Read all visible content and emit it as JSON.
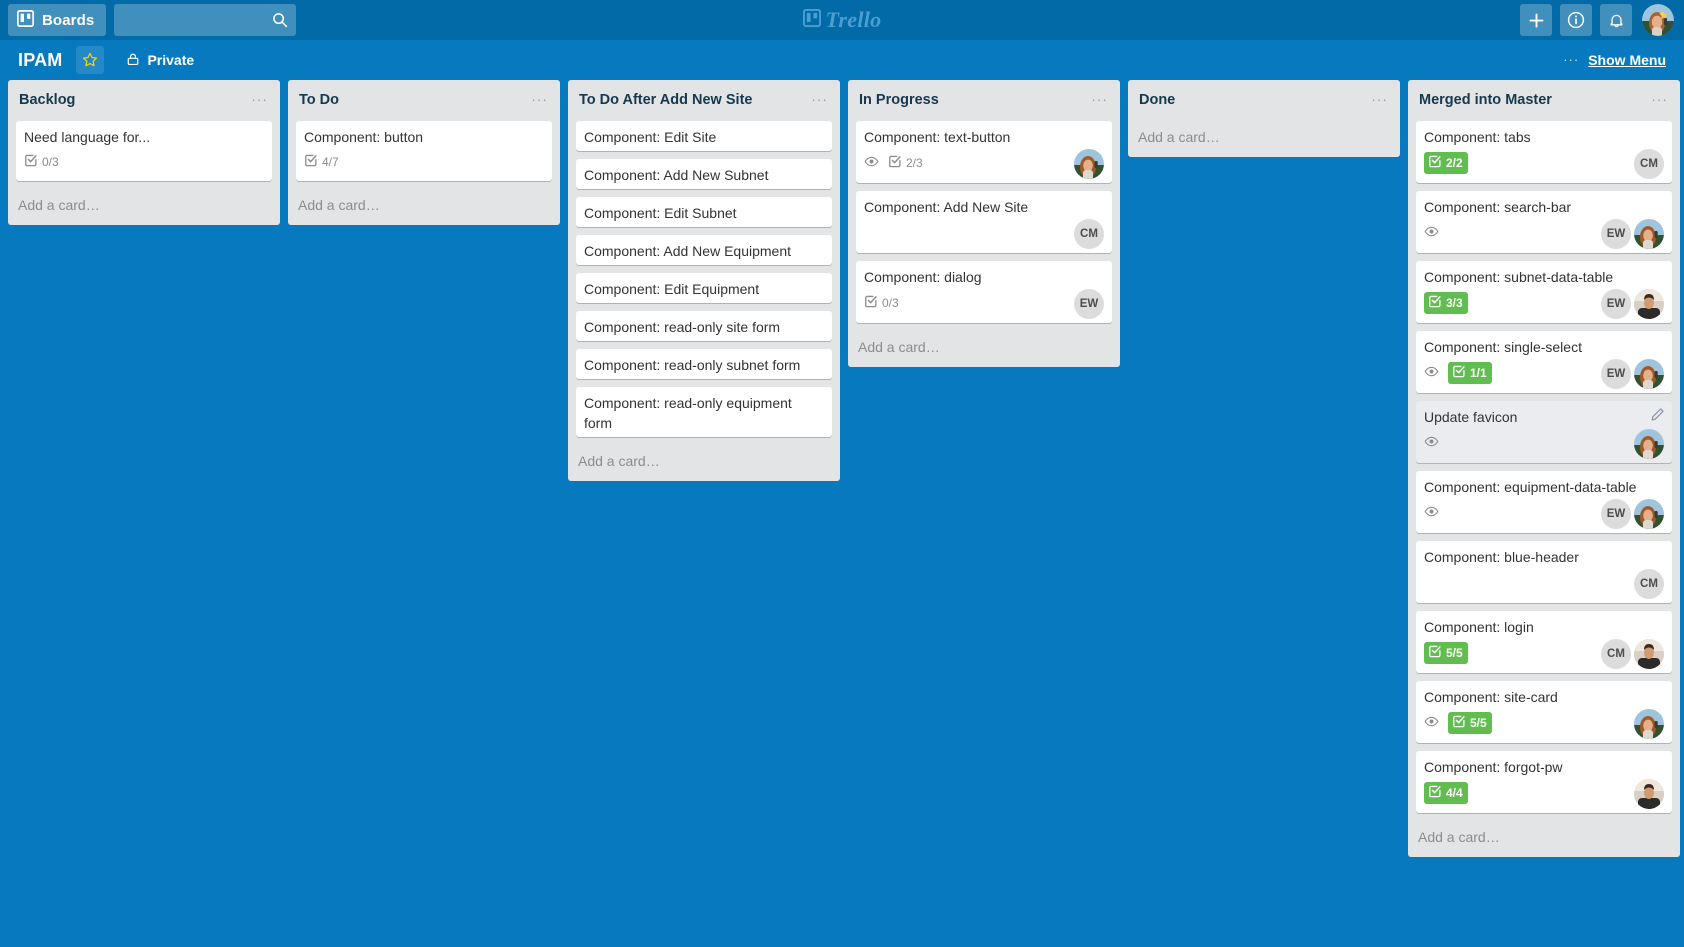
{
  "header": {
    "boards_label": "Boards",
    "search_placeholder": "",
    "search_value": "",
    "logo_text": "Trello",
    "icons": {
      "boards": "boards-icon",
      "search": "search-icon",
      "add": "plus-icon",
      "info": "info-icon",
      "notifications": "bell-icon",
      "avatar": "user-avatar"
    }
  },
  "board": {
    "title": "IPAM",
    "starred": true,
    "visibility": "Private",
    "dots": "···",
    "show_menu": "Show Menu"
  },
  "add_card_label": "Add a card…",
  "list_menu_dots": "···",
  "colors": {
    "board_bg": "#0679bf",
    "top_bar": "#026aa7",
    "list_bg": "#e2e4e6",
    "card_bg": "#ffffff",
    "badge_complete": "#61bd4f",
    "title_text": "#17394d"
  },
  "lists": [
    {
      "name": "Backlog",
      "cards": [
        {
          "title": "Need language for...",
          "badges": [
            {
              "type": "checklist",
              "text": "0/3",
              "complete": false
            }
          ],
          "members": []
        }
      ]
    },
    {
      "name": "To Do",
      "cards": [
        {
          "title": "Component: button",
          "badges": [
            {
              "type": "checklist",
              "text": "4/7",
              "complete": false
            }
          ],
          "members": []
        }
      ]
    },
    {
      "name": "To Do After Add New Site",
      "cards": [
        {
          "title": "Component: Edit Site",
          "badges": [],
          "members": []
        },
        {
          "title": "Component: Add New Subnet",
          "badges": [],
          "members": []
        },
        {
          "title": "Component: Edit Subnet",
          "badges": [],
          "members": []
        },
        {
          "title": "Component: Add New Equipment",
          "badges": [],
          "members": []
        },
        {
          "title": "Component: Edit Equipment",
          "badges": [],
          "members": []
        },
        {
          "title": "Component: read-only site form",
          "badges": [],
          "members": []
        },
        {
          "title": "Component: read-only subnet form",
          "badges": [],
          "members": []
        },
        {
          "title": "Component: read-only equipment form",
          "badges": [],
          "members": []
        }
      ]
    },
    {
      "name": "In Progress",
      "cards": [
        {
          "title": "Component: text-button",
          "badges": [
            {
              "type": "watch",
              "text": ""
            },
            {
              "type": "checklist",
              "text": "2/3",
              "complete": false
            }
          ],
          "members": [
            {
              "type": "photo",
              "photo": "woman"
            }
          ]
        },
        {
          "title": "Component: Add New Site",
          "badges": [],
          "members": [
            {
              "type": "initials",
              "initials": "CM"
            }
          ]
        },
        {
          "title": "Component: dialog",
          "badges": [
            {
              "type": "checklist",
              "text": "0/3",
              "complete": false
            }
          ],
          "members": [
            {
              "type": "initials",
              "initials": "EW"
            }
          ]
        }
      ]
    },
    {
      "name": "Done",
      "cards": []
    },
    {
      "name": "Merged into Master",
      "cards": [
        {
          "title": "Component: tabs",
          "badges": [
            {
              "type": "checklist",
              "text": "2/2",
              "complete": true
            }
          ],
          "members": [
            {
              "type": "initials",
              "initials": "CM"
            }
          ]
        },
        {
          "title": "Component: search-bar",
          "badges": [
            {
              "type": "watch",
              "text": ""
            }
          ],
          "members": [
            {
              "type": "initials",
              "initials": "EW"
            },
            {
              "type": "photo",
              "photo": "woman"
            }
          ]
        },
        {
          "title": "Component: subnet-data-table",
          "badges": [
            {
              "type": "checklist",
              "text": "3/3",
              "complete": true
            }
          ],
          "members": [
            {
              "type": "initials",
              "initials": "EW"
            },
            {
              "type": "photo",
              "photo": "man"
            }
          ]
        },
        {
          "title": "Component: single-select",
          "badges": [
            {
              "type": "watch",
              "text": ""
            },
            {
              "type": "checklist",
              "text": "1/1",
              "complete": true
            }
          ],
          "members": [
            {
              "type": "initials",
              "initials": "EW"
            },
            {
              "type": "photo",
              "photo": "woman"
            }
          ]
        },
        {
          "title": "Update favicon",
          "hovered": true,
          "edit_pencil": true,
          "badges": [
            {
              "type": "watch",
              "text": ""
            }
          ],
          "members": [
            {
              "type": "photo",
              "photo": "woman"
            }
          ]
        },
        {
          "title": "Component: equipment-data-table",
          "badges": [
            {
              "type": "watch",
              "text": ""
            }
          ],
          "members": [
            {
              "type": "initials",
              "initials": "EW"
            },
            {
              "type": "photo",
              "photo": "woman"
            }
          ]
        },
        {
          "title": "Component: blue-header",
          "badges": [],
          "members": [
            {
              "type": "initials",
              "initials": "CM"
            }
          ]
        },
        {
          "title": "Component: login",
          "badges": [
            {
              "type": "checklist",
              "text": "5/5",
              "complete": true
            }
          ],
          "members": [
            {
              "type": "initials",
              "initials": "CM"
            },
            {
              "type": "photo",
              "photo": "man"
            }
          ]
        },
        {
          "title": "Component: site-card",
          "badges": [
            {
              "type": "watch",
              "text": ""
            },
            {
              "type": "checklist",
              "text": "5/5",
              "complete": true
            }
          ],
          "members": [
            {
              "type": "photo",
              "photo": "woman"
            }
          ]
        },
        {
          "title": "Component: forgot-pw",
          "badges": [
            {
              "type": "checklist",
              "text": "4/4",
              "complete": true
            }
          ],
          "members": [
            {
              "type": "photo",
              "photo": "man"
            }
          ]
        }
      ]
    }
  ]
}
